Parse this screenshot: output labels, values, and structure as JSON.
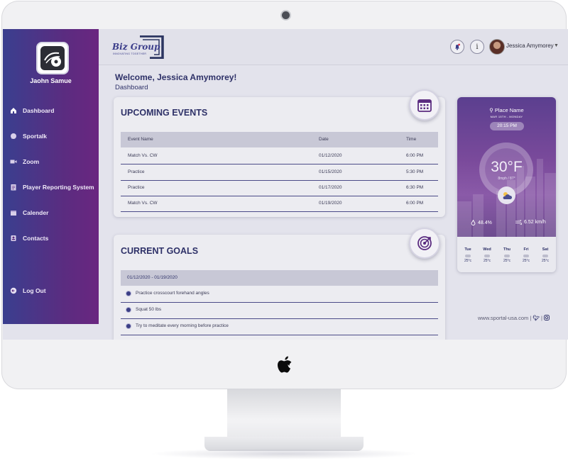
{
  "sidebar": {
    "user_name": "Jaohn Samue",
    "items": [
      {
        "label": "Dashboard",
        "icon": "home-icon"
      },
      {
        "label": "Sportalk",
        "icon": "chat-icon"
      },
      {
        "label": "Zoom",
        "icon": "video-icon"
      },
      {
        "label": "Player Reporting System",
        "icon": "report-icon"
      },
      {
        "label": "Calender",
        "icon": "calendar-icon"
      },
      {
        "label": "Contacts",
        "icon": "contacts-icon"
      }
    ],
    "logout_label": "Log Out"
  },
  "header": {
    "logo_text": "Biz Group",
    "logo_tagline": "INNOVATING TOGETHER",
    "user_name": "Jessica Amymorey",
    "icons": [
      "bell-icon",
      "info-icon",
      "chevron-down-icon"
    ]
  },
  "page": {
    "welcome": "Welcome, Jessica Amymorey!",
    "subtitle": "Dashboard"
  },
  "events": {
    "title": "UPCOMING EVENTS",
    "columns": [
      "Event Name",
      "Date",
      "Time"
    ],
    "rows": [
      {
        "name": "Match Vs. CW",
        "date": "01/12/2020",
        "time": "6:00 PM"
      },
      {
        "name": "Practice",
        "date": "01/15/2020",
        "time": "5:30 PM"
      },
      {
        "name": "Practice",
        "date": "01/17/2020",
        "time": "6:30 PM"
      },
      {
        "name": "Match Vs. CW",
        "date": "01/19/2020",
        "time": "6:00 PM"
      }
    ]
  },
  "goals": {
    "title": "CURRENT GOALS",
    "range": "01/12/2020 - 01/19/2020",
    "items": [
      "Practice crosscourt forehand angles",
      "Squat 50 lbs",
      "Try to meditate every morning before practice"
    ]
  },
  "weather": {
    "place": "Place Name",
    "date": "MAR 15TH - MONDAY",
    "time": "20:15 PM",
    "temp": "30°F",
    "wind_sub": "8mph / 87°",
    "humidity": "48.4%",
    "wind_speed": "6.52 km/h",
    "days": [
      {
        "day": "Tue",
        "temp": "25°c"
      },
      {
        "day": "Wed",
        "temp": "25°c"
      },
      {
        "day": "Thu",
        "temp": "25°c"
      },
      {
        "day": "Fri",
        "temp": "25°c"
      },
      {
        "day": "Sat",
        "temp": "25°c"
      }
    ]
  },
  "footer": {
    "site": "www.sportal-usa.com |",
    "social": [
      "twitter-icon",
      "instagram-icon"
    ]
  }
}
